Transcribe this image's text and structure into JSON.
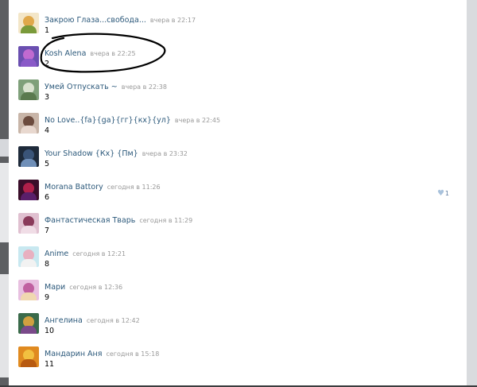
{
  "comments": [
    {
      "name": "Закрою Глаза...свобода...",
      "time": "вчера в 22:17",
      "text": "1",
      "colors": [
        "#f3e6c8",
        "#e0a84a",
        "#7a9a3a"
      ]
    },
    {
      "name": "Kosh Alena",
      "time": "вчера в 22:25",
      "text": "2",
      "colors": [
        "#6a4fb0",
        "#c06ad0",
        "#8a5ac8"
      ]
    },
    {
      "name": "Умей Отпускать ~",
      "time": "вчера в 22:38",
      "text": "3",
      "colors": [
        "#7fa07a",
        "#d9e2cf",
        "#5a7a4e"
      ]
    },
    {
      "name": "No Love..{fa}{ga}{гг}{кх}{ул}",
      "time": "вчера в 22:45",
      "text": "4",
      "colors": [
        "#c8b5a8",
        "#6b4b3e",
        "#e8d8cf"
      ]
    },
    {
      "name": "Your Shadow {Кх} {Пм}",
      "time": "вчера в 23:32",
      "text": "5",
      "colors": [
        "#1e2a3a",
        "#3a5478",
        "#6f8fb8"
      ]
    },
    {
      "name": "Morana Battory",
      "time": "сегодня в 11:26",
      "text": "6",
      "colors": [
        "#3a0e2a",
        "#b0204a",
        "#5a1f6a"
      ]
    },
    {
      "name": "Фантастическая Тварь",
      "time": "сегодня в 11:29",
      "text": "7",
      "colors": [
        "#e0c0d0",
        "#8a3a5a",
        "#f0dde6"
      ]
    },
    {
      "name": "Anime",
      "time": "сегодня в 12:21",
      "text": "8",
      "colors": [
        "#c8e8f0",
        "#e8b0c0",
        "#f2f2f2"
      ]
    },
    {
      "name": "Мари",
      "time": "сегодня в 12:36",
      "text": "9",
      "colors": [
        "#e8c0e0",
        "#c060a0",
        "#f0d8b0"
      ]
    },
    {
      "name": "Ангелина",
      "time": "сегодня в 12:42",
      "text": "10",
      "colors": [
        "#3a6a4a",
        "#d0a040",
        "#7a4a8a"
      ]
    },
    {
      "name": "Мандарин Аня",
      "time": "сегодня в 15:18",
      "text": "11",
      "colors": [
        "#e08a20",
        "#f2c040",
        "#b85a10"
      ]
    }
  ],
  "like": {
    "icon": "heart-icon",
    "count": "1",
    "comment_index": 5
  },
  "colors": {
    "link": "#2b587a",
    "meta": "#999999"
  }
}
